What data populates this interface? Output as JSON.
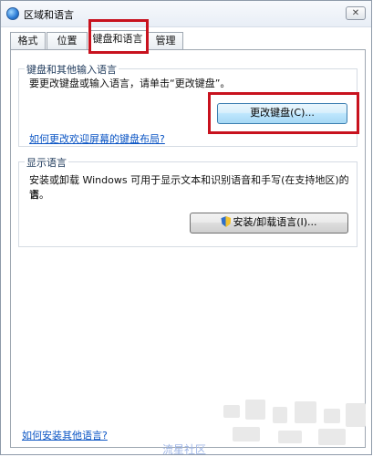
{
  "window": {
    "title": "区域和语言"
  },
  "tabs": [
    {
      "label": "格式"
    },
    {
      "label": "位置"
    },
    {
      "label": "键盘和语言"
    },
    {
      "label": "管理"
    }
  ],
  "keyboard_group": {
    "title": "键盘和其他输入语言",
    "description": "要更改键盘或输入语言，请单击“更改键盘”。",
    "change_button": "更改键盘(C)...",
    "welcome_link": "如何更改欢迎屏幕的键盘布局?"
  },
  "display_group": {
    "title": "显示语言",
    "description_line1": "安装或卸载 Windows 可用于显示文本和识别语音和手写(在支持地区)的语",
    "description_line2": "言。",
    "install_button": "安装/卸载语言(I)..."
  },
  "footer": {
    "install_link": "如何安装其他语言?"
  },
  "watermark": {
    "text": "流星社区"
  },
  "colors": {
    "highlight": "#c8121e",
    "link": "#0b55c4"
  }
}
